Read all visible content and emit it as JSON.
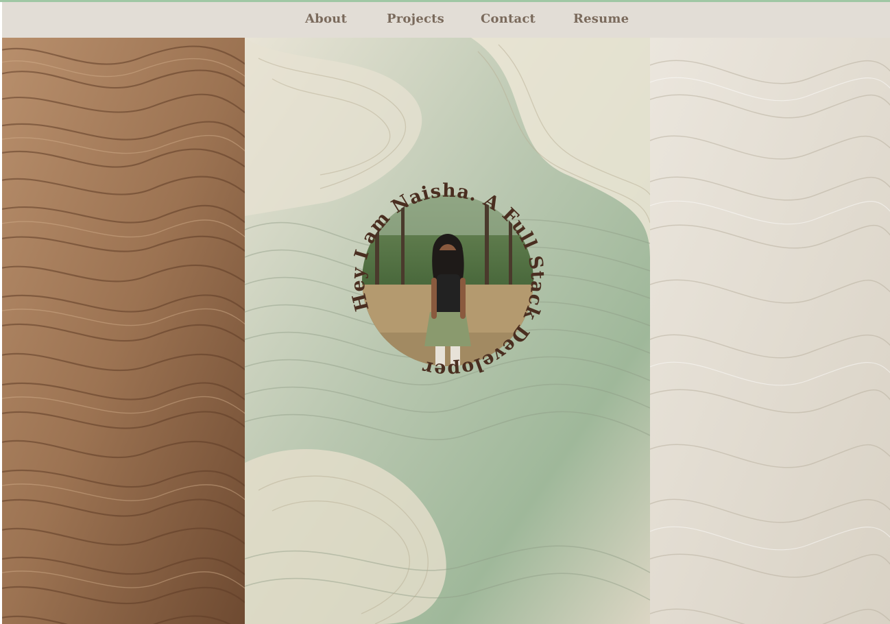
{
  "nav": {
    "items": [
      {
        "label": "About"
      },
      {
        "label": "Projects"
      },
      {
        "label": "Contact"
      },
      {
        "label": "Resume"
      }
    ]
  },
  "hero": {
    "circular_text": "Hey I am Naisha.  A Full Stack Developer",
    "photo_icon": "profile-photo"
  },
  "colors": {
    "accent_line": "#9fc7a4",
    "navbar_bg": "#e2ddd6",
    "nav_text": "#7a6a5c",
    "hero_text": "#4a2e20",
    "left_panel": "#a67c5b",
    "center_panel": "#c9d0bd",
    "right_panel": "#e8e2d8"
  }
}
